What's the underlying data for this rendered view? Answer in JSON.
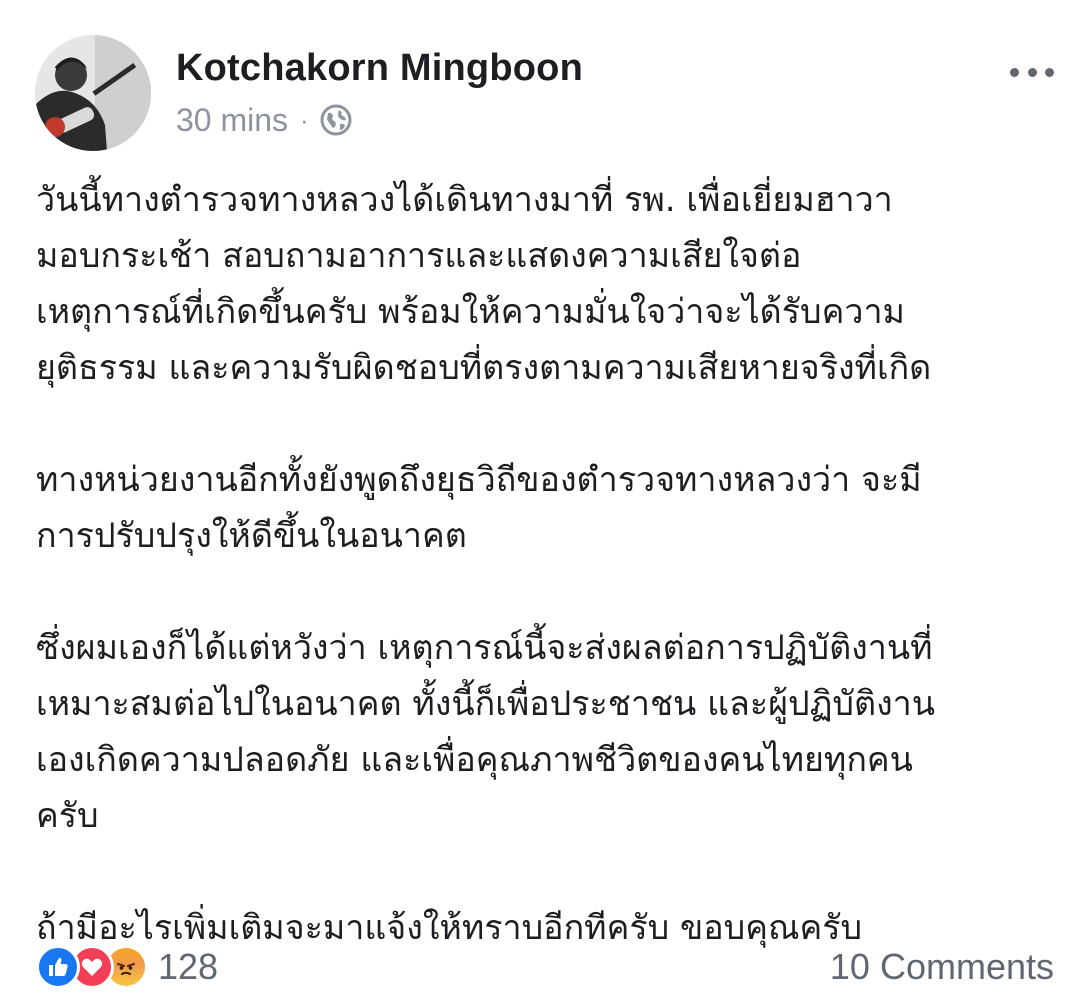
{
  "post": {
    "author": "Kotchakorn Mingboon",
    "timestamp": "30 mins",
    "separator": "·",
    "privacy_icon": "globe-icon",
    "paragraphs": [
      "วันนี้ทางตำรวจทางหลวงได้เดินทางมาที่ รพ. เพื่อเยี่ยมฮาวา\nมอบกระเช้า สอบถามอาการและแสดงความเสียใจต่อ\nเหตุการณ์ที่เกิดขึ้นครับ พร้อมให้ความมั่นใจว่าจะได้รับความ\nยุติธรรม และความรับผิดชอบที่ตรงตามความเสียหายจริงที่เกิด",
      "ทางหน่วยงานอีกทั้งยังพูดถึงยุธวิถีของตำรวจทางหลวงว่า จะมี\nการปรับปรุงให้ดีขึ้นในอนาคต",
      "ซึ่งผมเองก็ได้แต่หวังว่า เหตุการณ์นี้จะส่งผลต่อการปฏิบัติงานที่\nเหมาะสมต่อไปในอนาคต ทั้งนี้ก็เพื่อประชาชน และผู้ปฏิบัติงาน\nเองเกิดความปลอดภัย และเพื่อคุณภาพชีวิตของคนไทยทุกคน\nครับ",
      "ถ้ามีอะไรเพิ่มเติมจะมาแจ้งให้ทราบอีกทีครับ ขอบคุณครับ"
    ]
  },
  "reactions": {
    "icons": [
      "like-icon",
      "love-icon",
      "angry-icon"
    ],
    "count": "128"
  },
  "comments": {
    "label": "10 Comments"
  },
  "colors": {
    "text": "#1c1e21",
    "meta": "#8d949e",
    "like": "#1877f2",
    "love": "#f33e58",
    "angry": "#f5a623"
  }
}
